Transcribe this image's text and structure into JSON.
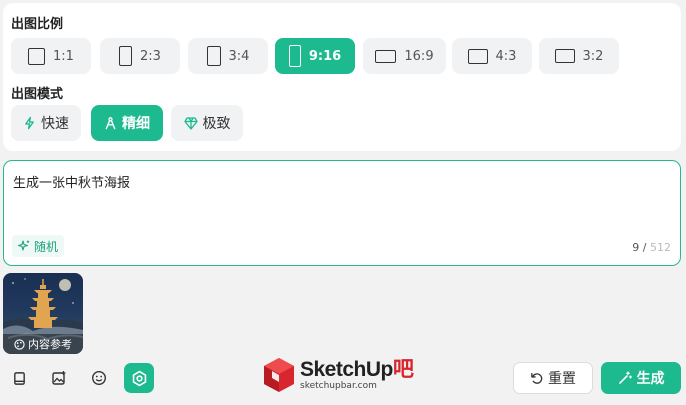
{
  "ratio_section": {
    "title": "出图比例",
    "options": [
      {
        "label": "1:1",
        "active": false
      },
      {
        "label": "2:3",
        "active": false
      },
      {
        "label": "3:4",
        "active": false
      },
      {
        "label": "9:16",
        "active": true
      },
      {
        "label": "16:9",
        "active": false
      },
      {
        "label": "4:3",
        "active": false
      },
      {
        "label": "3:2",
        "active": false
      }
    ]
  },
  "mode_section": {
    "title": "出图模式",
    "options": [
      {
        "label": "快速",
        "icon": "lightning-icon",
        "active": false
      },
      {
        "label": "精细",
        "icon": "compass-icon",
        "active": true
      },
      {
        "label": "极致",
        "icon": "diamond-icon",
        "active": false
      }
    ]
  },
  "prompt": {
    "text": "生成一张中秋节海报",
    "random_label": "随机",
    "count": "9",
    "separator": " / ",
    "max": "512"
  },
  "reference": {
    "label": "内容参考"
  },
  "logo": {
    "main_text": "SketchUp",
    "main_suffix": "吧",
    "sub_text": "sketchupbar.com"
  },
  "actions": {
    "reset_label": "重置",
    "generate_label": "生成"
  },
  "colors": {
    "accent": "#1db98f",
    "border_accent": "#28b88e",
    "logo_red": "#d8262e"
  }
}
